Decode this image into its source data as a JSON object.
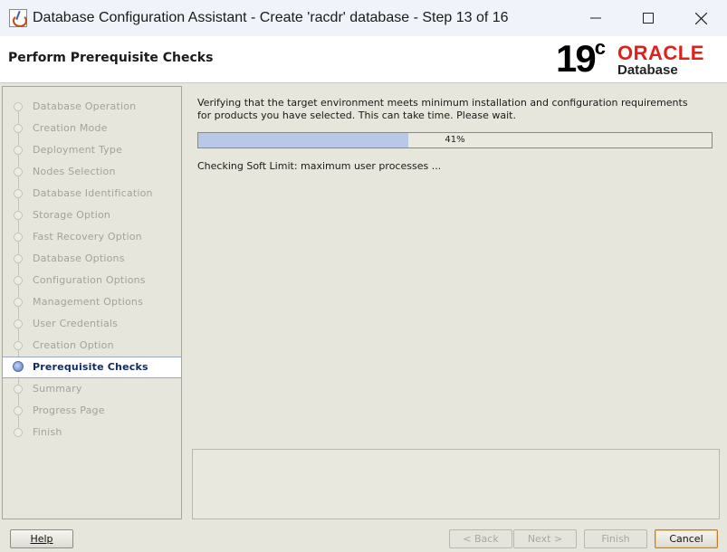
{
  "window": {
    "title": "Database Configuration Assistant - Create 'racdr' database - Step 13 of 16"
  },
  "header": {
    "page_title": "Perform Prerequisite Checks",
    "logo_version": "19",
    "logo_version_sup": "c",
    "logo_brand": "ORACLE",
    "logo_product": "Database"
  },
  "sidebar": {
    "steps": [
      {
        "label": "Database Operation",
        "state": "done"
      },
      {
        "label": "Creation Mode",
        "state": "done"
      },
      {
        "label": "Deployment Type",
        "state": "done"
      },
      {
        "label": "Nodes Selection",
        "state": "done"
      },
      {
        "label": "Database Identification",
        "state": "done"
      },
      {
        "label": "Storage Option",
        "state": "done"
      },
      {
        "label": "Fast Recovery Option",
        "state": "done"
      },
      {
        "label": "Database Options",
        "state": "done"
      },
      {
        "label": "Configuration Options",
        "state": "done"
      },
      {
        "label": "Management Options",
        "state": "done"
      },
      {
        "label": "User Credentials",
        "state": "done"
      },
      {
        "label": "Creation Option",
        "state": "done"
      },
      {
        "label": "Prerequisite Checks",
        "state": "active"
      },
      {
        "label": "Summary",
        "state": "pending"
      },
      {
        "label": "Progress Page",
        "state": "pending"
      },
      {
        "label": "Finish",
        "state": "pending"
      }
    ]
  },
  "main": {
    "intro_line1": "Verifying that the target environment meets minimum installation and configuration requirements",
    "intro_line2": "for products you have selected. This can take time. Please wait.",
    "progress_value": 0.41,
    "progress_label": "41%",
    "status": "Checking Soft Limit: maximum user processes ..."
  },
  "footer": {
    "help": "Help",
    "back": "< Back",
    "next": "Next >",
    "finish": "Finish",
    "cancel": "Cancel"
  },
  "colors": {
    "active_step_text": "#0f2a66",
    "progress_fill": "#b8c9e8",
    "oracle_red": "#e0211b"
  }
}
